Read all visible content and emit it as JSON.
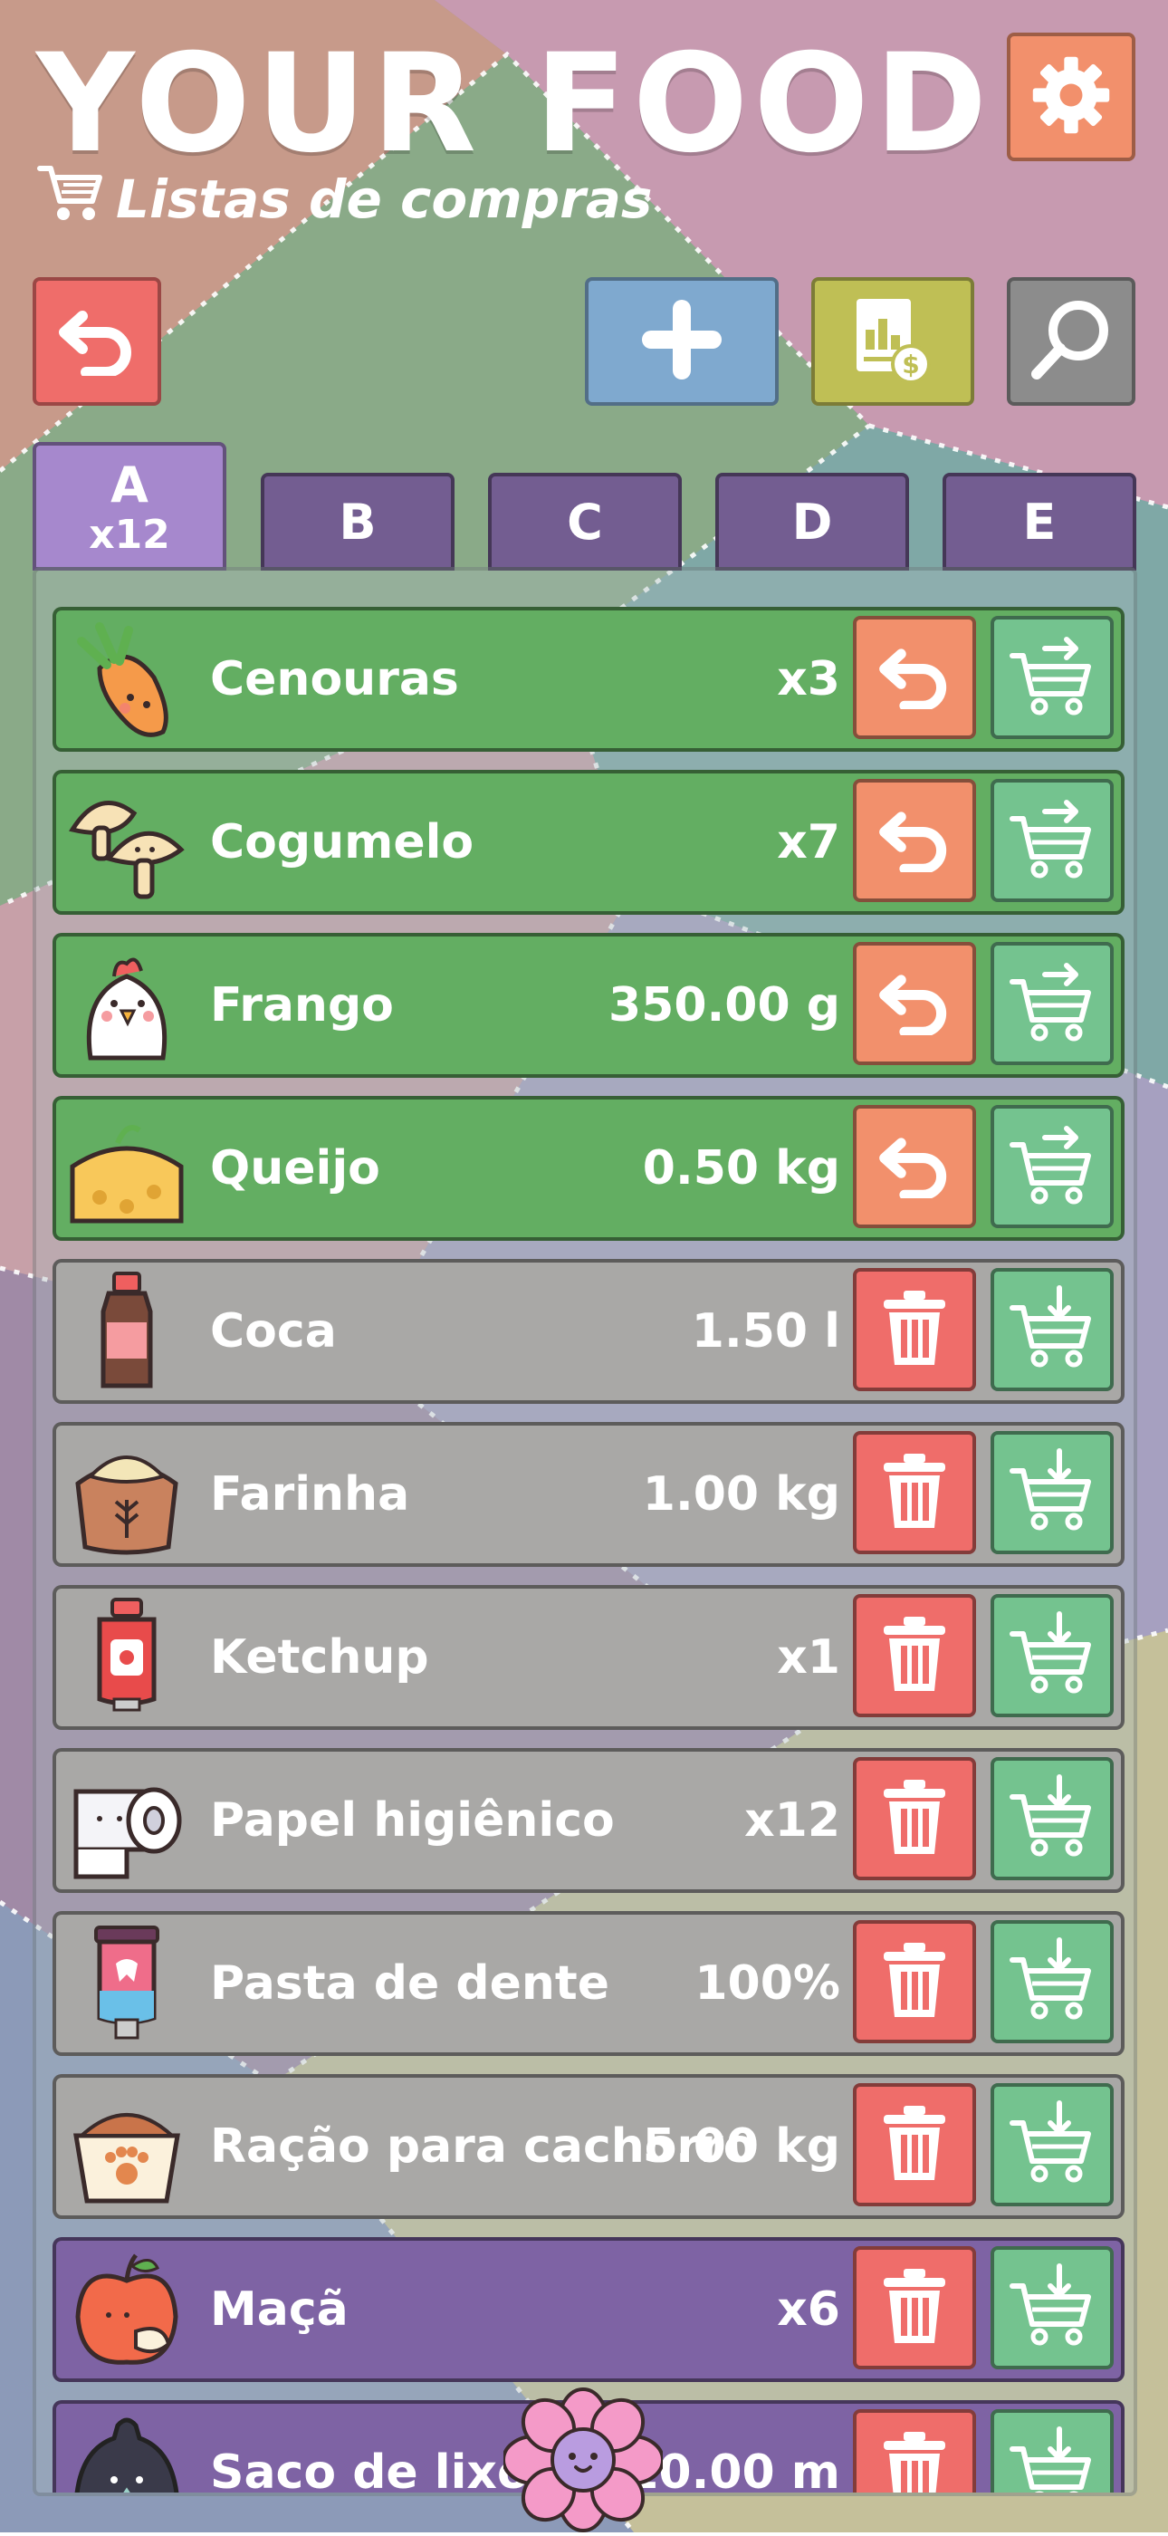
{
  "app": {
    "title": "YOUR FOOD",
    "subtitle": "Listas de compras",
    "subtitle_icon": "shopping-cart-icon"
  },
  "toolbar": {
    "settings_icon": "gear-icon",
    "back_icon": "undo-arrow-icon",
    "add_icon": "plus-icon",
    "report_icon": "price-report-icon",
    "search_icon": "magnifier-icon"
  },
  "tabs": [
    {
      "label": "A",
      "count": "x12",
      "active": true
    },
    {
      "label": "B",
      "count": "",
      "active": false
    },
    {
      "label": "C",
      "count": "",
      "active": false
    },
    {
      "label": "D",
      "count": "",
      "active": false
    },
    {
      "label": "E",
      "count": "",
      "active": false
    }
  ],
  "items": [
    {
      "name": "Cenouras",
      "qty": "x3",
      "state": "in-cart",
      "icon": "carrot-icon",
      "action": "undo-icon"
    },
    {
      "name": "Cogumelo",
      "qty": "x7",
      "state": "in-cart",
      "icon": "mushroom-icon",
      "action": "undo-icon"
    },
    {
      "name": "Frango",
      "qty": "350.00 g",
      "state": "in-cart",
      "icon": "chicken-icon",
      "action": "undo-icon"
    },
    {
      "name": "Queijo",
      "qty": "0.50 kg",
      "state": "in-cart",
      "icon": "cheese-icon",
      "action": "undo-icon"
    },
    {
      "name": "Coca",
      "qty": "1.50 l",
      "state": "pending",
      "icon": "soda-bottle-icon",
      "action": "trash-icon"
    },
    {
      "name": "Farinha",
      "qty": "1.00 kg",
      "state": "pending",
      "icon": "flour-sack-icon",
      "action": "trash-icon"
    },
    {
      "name": "Ketchup",
      "qty": "x1",
      "state": "pending",
      "icon": "ketchup-icon",
      "action": "trash-icon"
    },
    {
      "name": "Papel higiênico",
      "qty": "x12",
      "state": "pending",
      "icon": "toilet-paper-icon",
      "action": "trash-icon"
    },
    {
      "name": "Pasta de dente",
      "qty": "100%",
      "state": "pending",
      "icon": "toothpaste-icon",
      "action": "trash-icon"
    },
    {
      "name": "Ração para cachorro",
      "qty": "5.00 kg",
      "state": "pending",
      "icon": "dog-food-icon",
      "action": "trash-icon"
    },
    {
      "name": "Maçã",
      "qty": "x6",
      "state": "highlight",
      "icon": "apple-icon",
      "action": "trash-icon"
    },
    {
      "name": "Saco de lixo",
      "qty": "10.00 m",
      "state": "highlight",
      "icon": "trash-bag-icon",
      "action": "trash-icon"
    }
  ],
  "colors": {
    "in_cart_row": "#63ae62",
    "pending_row": "#a9a8a6",
    "highlight_row": "#7e63a4",
    "undo_button": "#f2906c",
    "delete_button": "#ef6d6a",
    "cart_button": "#74c38f",
    "add_button": "#7fa9cf",
    "report_button": "#bfbf55",
    "search_button": "#8c8c8c",
    "settings_button": "#f2906c",
    "back_button": "#ef6d6a",
    "tab_active": "#a688cd",
    "tab_inactive": "#735d91"
  }
}
